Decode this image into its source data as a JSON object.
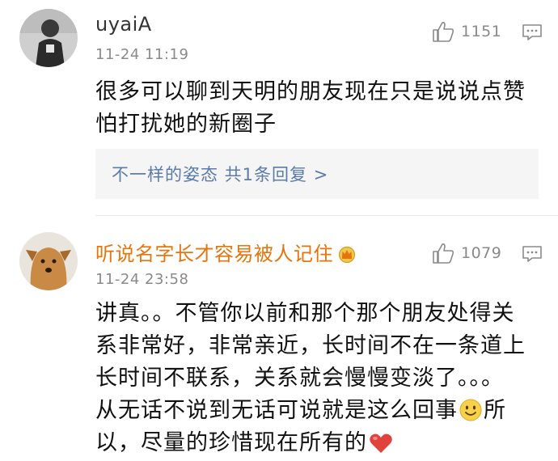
{
  "comments": [
    {
      "username": "uyaiA",
      "timestamp": "11-24 11:19",
      "likes": "1151",
      "text": "很多可以聊到天明的朋友现在只是说说点赞\n怕打扰她的新圈子",
      "replies_link": "不一样的姿态 共1条回复 >"
    },
    {
      "username": "听说名字长才容易被人记住",
      "timestamp": "11-24 23:58",
      "likes": "1079",
      "text_part1": "讲真。。不管你以前和那个那个朋友处得关\n系非常好，非常亲近，长时间不在一条道上\n长时间不联系，关系就会慢慢变淡了。。。\n从无话不说到无话可说就是这么回事",
      "text_part2": "所\n以，尽量的珍惜现在所有的"
    }
  ],
  "icons": {
    "like": "thumbs-up-icon",
    "reply": "comment-bubble-icon",
    "crown": "crown-badge-icon",
    "smile": "smile-emoji-icon",
    "heart": "heart-emoji-icon"
  },
  "colors": {
    "link": "#5b7bab",
    "username_highlight": "#e8740c",
    "meta_gray": "#8a8a8a",
    "reply_box_bg": "#f5f5f5",
    "heart": "#e0433c"
  }
}
